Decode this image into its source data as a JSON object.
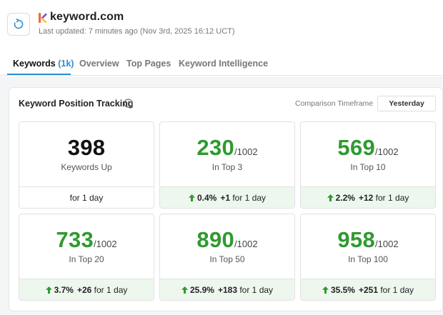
{
  "header": {
    "site_name": "keyword.com",
    "last_updated": "Last updated: 7 minutes ago (Nov 3rd, 2025 16:12 UCT)"
  },
  "tabs": [
    {
      "label": "Keywords",
      "count": "(1k)",
      "active": true
    },
    {
      "label": "Overview"
    },
    {
      "label": "Top Pages"
    },
    {
      "label": "Keyword Intelligence"
    }
  ],
  "panel": {
    "title": "Keyword Position Tracking",
    "comparison_label": "Comparison Timeframe",
    "comparison_value": "Yesterday"
  },
  "cards": [
    {
      "value": "398",
      "denom": "",
      "label": "Keywords Up",
      "pct": "",
      "delta": "",
      "period": "for 1 day",
      "trend": "none"
    },
    {
      "value": "230",
      "denom": "/1002",
      "label": "In Top 3",
      "pct": "0.4%",
      "delta": "+1",
      "period": "for 1 day",
      "trend": "up"
    },
    {
      "value": "569",
      "denom": "/1002",
      "label": "In Top 10",
      "pct": "2.2%",
      "delta": "+12",
      "period": "for 1 day",
      "trend": "up"
    },
    {
      "value": "733",
      "denom": "/1002",
      "label": "In Top 20",
      "pct": "3.7%",
      "delta": "+26",
      "period": "for 1 day",
      "trend": "up"
    },
    {
      "value": "890",
      "denom": "/1002",
      "label": "In Top 50",
      "pct": "25.9%",
      "delta": "+183",
      "period": "for 1 day",
      "trend": "up"
    },
    {
      "value": "958",
      "denom": "/1002",
      "label": "In Top 100",
      "pct": "35.5%",
      "delta": "+251",
      "period": "for 1 day",
      "trend": "up"
    }
  ],
  "colors": {
    "accent_blue": "#2b8fd6",
    "positive_green": "#2f9a2f",
    "positive_bg": "#eef7ee"
  },
  "icons": {
    "refresh": "refresh-icon",
    "info": "info-icon",
    "trend_up": "arrow-up-icon",
    "logo": "keyword-logo-icon"
  }
}
